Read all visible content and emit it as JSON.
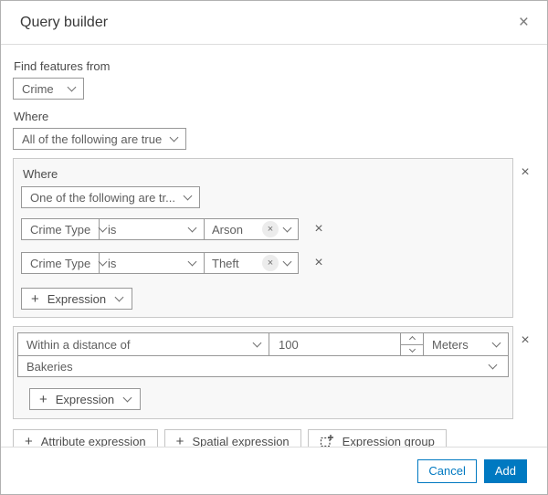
{
  "dialog": {
    "title": "Query builder"
  },
  "icons": {
    "close": "×",
    "remove": "×",
    "chip_remove": "×",
    "plus": "+"
  },
  "intro": {
    "find_label": "Find features from",
    "layer_value": "Crime",
    "where_label": "Where",
    "combine_value": "All of the following are true"
  },
  "group1": {
    "where_label": "Where",
    "combine_value": "One of the following are tr...",
    "rows": [
      {
        "field": "Crime Type",
        "operator": "is",
        "value": "Arson"
      },
      {
        "field": "Crime Type",
        "operator": "is",
        "value": "Theft"
      }
    ],
    "add_expression": "Expression"
  },
  "group2": {
    "mode_value": "Within a distance of",
    "distance_value": "100",
    "unit_value": "Meters",
    "layer_value": "Bakeries",
    "add_expression": "Expression"
  },
  "actions": {
    "attribute": "Attribute expression",
    "spatial": "Spatial expression",
    "group": "Expression group"
  },
  "footer": {
    "cancel": "Cancel",
    "add": "Add"
  },
  "colors": {
    "accent": "#0079c1",
    "group_bg": "#f8f8f8",
    "control_border": "#989898"
  }
}
